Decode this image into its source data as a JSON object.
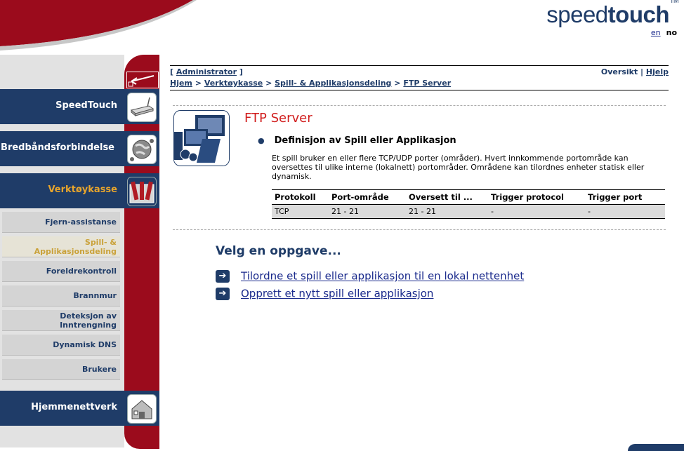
{
  "brand": {
    "logo_light": "speed",
    "logo_bold": "touch",
    "tm": "TM"
  },
  "lang": {
    "en": "en",
    "no": "no"
  },
  "nav": {
    "speedtouch": "SpeedTouch",
    "broadband": "Bredbåndsforbindelse",
    "tools": "Verktøykasse",
    "home_network": "Hjemmenettverk"
  },
  "subnav": [
    {
      "label": "Fjern-assistanse"
    },
    {
      "label": "Spill- & Applikasjonsdeling"
    },
    {
      "label": "Foreldrekontroll"
    },
    {
      "label": "Brannmur"
    },
    {
      "label": "Deteksjon av Inntrengning"
    },
    {
      "label": "Dynamisk DNS"
    },
    {
      "label": "Brukere"
    }
  ],
  "header": {
    "user_open": "[",
    "user": "Administrator",
    "user_close": "]",
    "overview": "Oversikt",
    "sep": "|",
    "help": "Hjelp"
  },
  "breadcrumb": {
    "home": "Hjem",
    "tools": "Verktøykasse",
    "sharing": "Spill- & Applikasjonsdeling",
    "current": "FTP Server",
    "sep": ">"
  },
  "page": {
    "title": "FTP Server",
    "definition_heading": "Definisjon av Spill eller Applikasjon",
    "description": "Et spill bruker en eller flere TCP/UDP porter (områder). Hvert innkommende portområde kan oversettes til ulike interne (lokalnett) portområder. Områdene kan tilordnes enheter statisk eller dynamisk."
  },
  "table": {
    "headers": [
      "Protokoll",
      "Port-område",
      "Oversett til ...",
      "Trigger protocol",
      "Trigger port"
    ],
    "rows": [
      [
        "TCP",
        "21 - 21",
        "21 - 21",
        "-",
        "-"
      ]
    ]
  },
  "tasks": {
    "heading": "Velg en oppgave...",
    "items": [
      {
        "label": "Tilordne et spill eller applikasjon til en lokal nettenhet"
      },
      {
        "label": "Opprett et nytt spill eller applikasjon"
      }
    ]
  },
  "colors": {
    "navy": "#1f3c68",
    "red": "#9b0b1c",
    "title_red": "#d11e1e",
    "active_orange": "#e8a52c"
  }
}
